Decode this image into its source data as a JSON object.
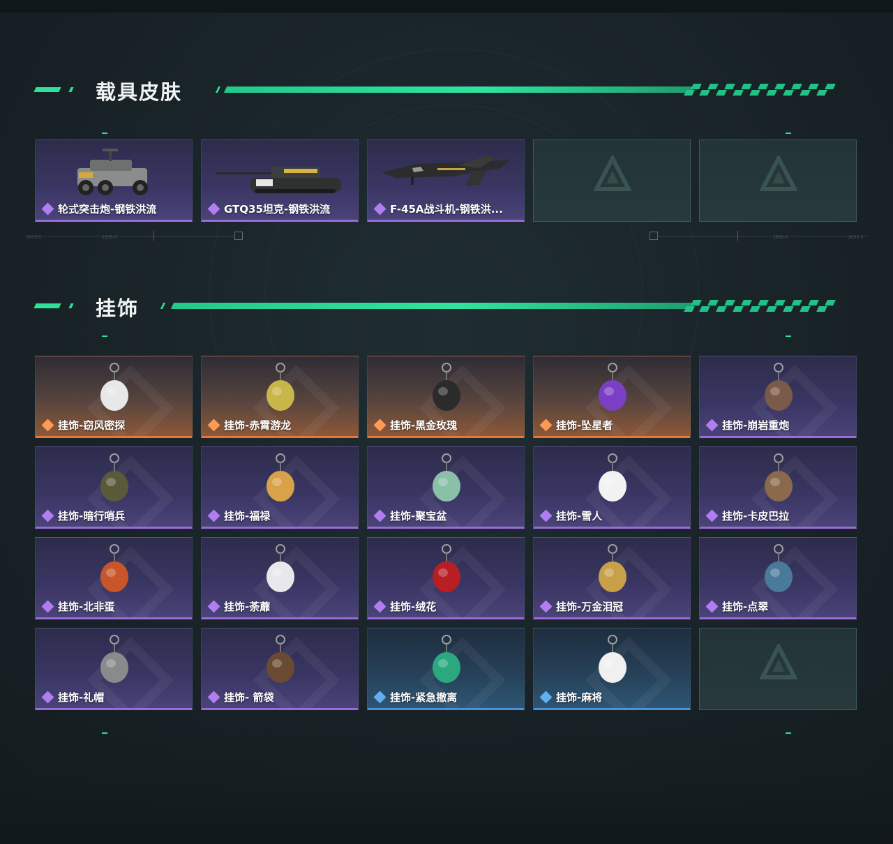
{
  "sections": {
    "vehicle": {
      "title": "载具皮肤",
      "items": [
        {
          "label": "轮式突击炮-钢铁洪流",
          "rarity": "purple",
          "icon": "armored-car-image"
        },
        {
          "label": "GTQ35坦克-钢铁洪流",
          "rarity": "purple",
          "icon": "tank-image"
        },
        {
          "label": "F-45A战斗机-钢铁洪...",
          "rarity": "purple",
          "icon": "fighter-jet-image"
        },
        {
          "label": "",
          "rarity": "empty",
          "icon": "placeholder-logo"
        },
        {
          "label": "",
          "rarity": "empty",
          "icon": "placeholder-logo"
        }
      ]
    },
    "charms": {
      "title": "挂饰",
      "items": [
        {
          "label": "挂饰-窃风密探",
          "rarity": "orange",
          "icon": "charm-rabbit-detective"
        },
        {
          "label": "挂饰-赤霄游龙",
          "rarity": "orange",
          "icon": "charm-dragon"
        },
        {
          "label": "挂饰-黑金玫瑰",
          "rarity": "orange",
          "icon": "charm-black-rose"
        },
        {
          "label": "挂饰-坠星者",
          "rarity": "orange",
          "icon": "charm-purple-crystal"
        },
        {
          "label": "挂饰-崩岩重炮",
          "rarity": "purple",
          "icon": "charm-rock-gunner"
        },
        {
          "label": "挂饰-暗行哨兵",
          "rarity": "purple",
          "icon": "charm-sentinel"
        },
        {
          "label": "挂饰-福禄",
          "rarity": "purple",
          "icon": "charm-gourd"
        },
        {
          "label": "挂饰-聚宝盆",
          "rarity": "purple",
          "icon": "charm-treasure-bowl"
        },
        {
          "label": "挂饰-雪人",
          "rarity": "purple",
          "icon": "charm-snowman"
        },
        {
          "label": "挂饰-卡皮巴拉",
          "rarity": "purple",
          "icon": "charm-capybara"
        },
        {
          "label": "挂饰-北非蛋",
          "rarity": "purple",
          "icon": "charm-shakshuka"
        },
        {
          "label": "挂饰-荼蘼",
          "rarity": "purple",
          "icon": "charm-white-flower"
        },
        {
          "label": "挂饰-绒花",
          "rarity": "purple",
          "icon": "charm-red-flower"
        },
        {
          "label": "挂饰-万金泪冠",
          "rarity": "purple",
          "icon": "charm-golden-crown"
        },
        {
          "label": "挂饰-点翠",
          "rarity": "purple",
          "icon": "charm-kingfisher"
        },
        {
          "label": "挂饰-礼帽",
          "rarity": "purple",
          "icon": "charm-hat"
        },
        {
          "label": "挂饰- 箭袋",
          "rarity": "purple",
          "icon": "charm-quiver"
        },
        {
          "label": "挂饰-紧急撤离",
          "rarity": "blue",
          "icon": "charm-emergency-exit"
        },
        {
          "label": "挂饰-麻将",
          "rarity": "blue",
          "icon": "charm-mahjong"
        },
        {
          "label": "",
          "rarity": "empty",
          "icon": "placeholder-logo"
        }
      ]
    }
  },
  "decor": {
    "timeline_left": [
      "2035-5",
      "1935-3"
    ],
    "timeline_right": [
      "1935-3",
      "2035-5"
    ]
  },
  "colors": {
    "accent": "#2ee09a",
    "purple_rarity": "#9a6bdb",
    "orange_rarity": "#e07a3a",
    "blue_rarity": "#4a93d6"
  }
}
